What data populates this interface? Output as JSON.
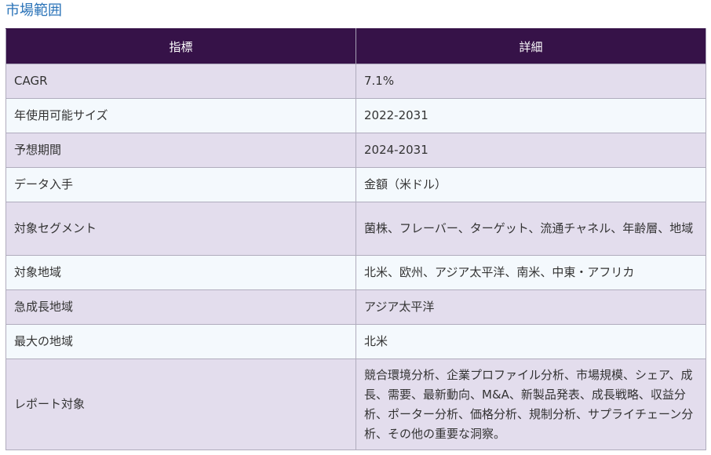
{
  "heading": "市場範囲",
  "table": {
    "headers": [
      "指標",
      "詳細"
    ],
    "rows": [
      [
        "CAGR",
        "7.1%"
      ],
      [
        "年使用可能サイズ",
        "2022-2031"
      ],
      [
        "予想期間",
        "2024-2031"
      ],
      [
        "データ入手",
        "金額（米ドル）"
      ],
      [
        "対象セグメント",
        "菌株、フレーバー、ターゲット、流通チャネル、年齢層、地域"
      ],
      [
        "対象地域",
        "北米、欧州、アジア太平洋、南米、中東・アフリカ"
      ],
      [
        "急成長地域",
        "アジア太平洋"
      ],
      [
        "最大の地域",
        "北米"
      ],
      [
        "レポート対象",
        "競合環境分析、企業プロファイル分析、市場規模、シェア、成長、需要、最新動向、M&A、新製品発表、成長戦略、収益分析、ポーター分析、価格分析、規制分析、サプライチェーン分析、その他の重要な洞察。"
      ]
    ]
  },
  "colors": {
    "heading_text": "#2a73b8",
    "header_bg": "#361248",
    "row_odd_bg": "#e3dded",
    "row_even_bg": "#f4f9fd",
    "border": "#b0acbd"
  }
}
